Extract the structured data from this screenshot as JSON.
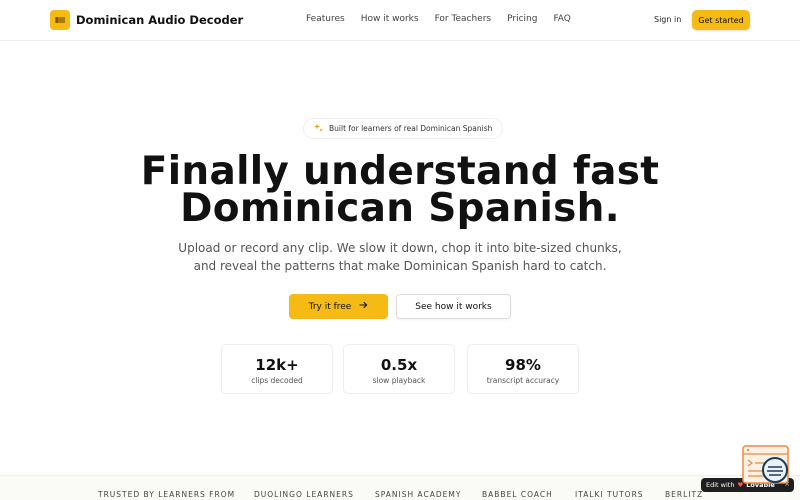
{
  "nav": {
    "brand": "Dominican Audio Decoder",
    "links": [
      "Features",
      "How it works",
      "For Teachers",
      "Pricing",
      "FAQ"
    ],
    "sign_in": "Sign in",
    "get_started": "Get started"
  },
  "hero": {
    "badge": "Built for learners of real Dominican Spanish",
    "title_line1": "Finally understand fast",
    "title_line2": "Dominican Spanish.",
    "subtitle_line1": "Upload or record any clip. We slow it down, chop it into bite-sized chunks,",
    "subtitle_line2": "and reveal the patterns that make Dominican Spanish hard to catch.",
    "primary_cta": "Try it free",
    "secondary_cta": "See how it works"
  },
  "stats": [
    {
      "value": "12k+",
      "label": "clips decoded"
    },
    {
      "value": "0.5x",
      "label": "slow playback"
    },
    {
      "value": "98%",
      "label": "transcript accuracy"
    }
  ],
  "trusted": {
    "label": "TRUSTED BY LEARNERS FROM",
    "names": [
      "DUOLINGO LEARNERS",
      "SPANISH ACADEMY",
      "BABBEL COACH",
      "ITALKI TUTORS",
      "BERLITZ"
    ]
  },
  "floating": {
    "edit_with": "Edit with",
    "edit_brand": "Lovable",
    "close": "×"
  },
  "icons": {
    "brand": "waveform-icon",
    "badge": "sparkles-icon",
    "cta": "arrow-right-icon"
  },
  "colors": {
    "accent": "#f5bb14",
    "text": "#111111",
    "muted": "#555555"
  }
}
